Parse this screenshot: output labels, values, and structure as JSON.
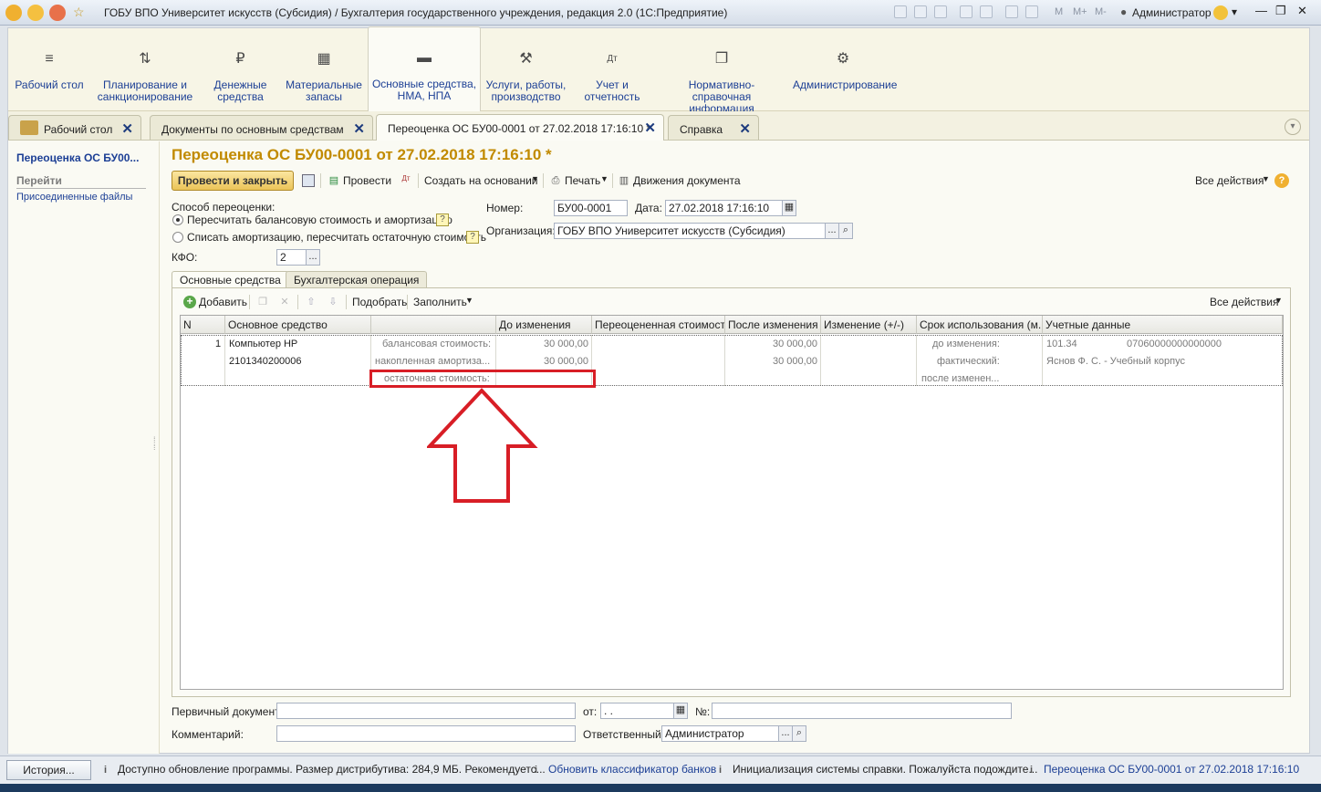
{
  "window": {
    "title": "ГОБУ ВПО Университет искусств (Субсидия) / Бухгалтерия государственного учреждения, редакция 2.0  (1С:Предприятие)",
    "user": "Администратор",
    "m_buttons": [
      "M",
      "M+",
      "M-"
    ]
  },
  "sections": [
    {
      "label": "Рабочий стол",
      "icon": "menu-icon"
    },
    {
      "label": "Планирование и санкционирование",
      "icon": "planning-icon"
    },
    {
      "label": "Денежные средства",
      "icon": "ruble-icon"
    },
    {
      "label": "Материальные запасы",
      "icon": "grid-icon"
    },
    {
      "label": "Основные средства, НМА, НПА",
      "icon": "truck-icon"
    },
    {
      "label": "Услуги, работы, производство",
      "icon": "tools-icon"
    },
    {
      "label": "Учет и отчетность",
      "icon": "dt-kt-icon"
    },
    {
      "label": "Нормативно-справочная информация",
      "icon": "docs-icon"
    },
    {
      "label": "Администрирование",
      "icon": "gear-icon"
    }
  ],
  "tabs": [
    "Рабочий стол",
    "Документы по основным средствам",
    "Переоценка ОС БУ00-0001 от 27.02.2018 17:16:10 *",
    "Справка"
  ],
  "left_panel": {
    "title": "Переоценка ОС БУ00...",
    "go": "Перейти",
    "files": "Присоединенные файлы"
  },
  "doc": {
    "title": "Переоценка ОС БУ00-0001 от 27.02.2018 17:16:10 *",
    "toolbar": {
      "post_close": "Провести и закрыть",
      "post": "Провести",
      "create_based": "Создать на основании",
      "print": "Печать",
      "movements": "Движения документа",
      "all_actions": "Все действия"
    },
    "method_label": "Способ переоценки:",
    "method_opt1": "Пересчитать балансовую стоимость и амортизацию",
    "method_opt2": "Списать амортизацию, пересчитать остаточную стоимость",
    "kfo_label": "КФО:",
    "kfo_value": "2",
    "number_label": "Номер:",
    "number_value": "БУ00-0001",
    "date_label": "Дата:",
    "date_value": "27.02.2018 17:16:10",
    "org_label": "Организация:",
    "org_value": "ГОБУ ВПО Университет искусств (Субсидия)",
    "inner_tabs": [
      "Основные средства",
      "Бухгалтерская операция"
    ],
    "table_toolbar": {
      "add": "Добавить",
      "pick": "Подобрать",
      "fill": "Заполнить",
      "all_actions": "Все действия"
    },
    "columns": [
      "N",
      "Основное средство",
      "",
      "До изменения",
      "Переоцененная стоимость",
      "После изменения",
      "Изменение (+/-)",
      "Срок использования (м...",
      "Учетные данные"
    ],
    "row": {
      "n": "1",
      "asset_name": "Компьютер HP",
      "asset_code": "2101340200006",
      "kind1": "балансовая стоимость:",
      "kind2": "накопленная амортиза...",
      "kind3": "остаточная стоимость:",
      "before1": "30 000,00",
      "before2": "30 000,00",
      "after1": "30 000,00",
      "after2": "30 000,00",
      "term1": "до изменения:",
      "term2": "фактический:",
      "term3": "после изменен...",
      "acc": "101.34",
      "acc_code": "07060000000000000",
      "person": "Яснов Ф. С. - Учебный корпус"
    },
    "primary_doc_label": "Первичный документ:",
    "from_label": "от:",
    "from_value": " .  .",
    "num_label": "№:",
    "comment_label": "Комментарий:",
    "responsible_label": "Ответственный:",
    "responsible_value": "Администратор"
  },
  "status": {
    "history": "История...",
    "msg1": "Доступно обновление программы. Размер дистрибутива: 284,9 МБ. Рекомендуетс...",
    "msg2": "Обновить классификатор банков",
    "msg3": "Инициализация системы справки. Пожалуйста подождите...",
    "msg4": "Переоценка ОС БУ00-0001 от 27.02.2018 17:16:10"
  },
  "colors": {
    "accent": "#c18a00",
    "link": "#1c3f95",
    "highlight": "#d81e26"
  }
}
